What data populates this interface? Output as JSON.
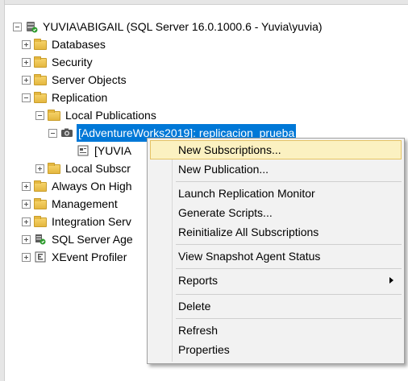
{
  "tree": {
    "server": "YUVIA\\ABIGAIL (SQL Server 16.0.1000.6 - Yuvia\\yuvia)",
    "databases": "Databases",
    "security": "Security",
    "server_objects": "Server Objects",
    "replication": "Replication",
    "local_publications": "Local Publications",
    "publication": "[AdventureWorks2019]: replicacion_prueba",
    "publication_child": "[YUVIA",
    "local_subscriptions": "Local Subscr",
    "always_on": "Always On High",
    "management": "Management",
    "integration": "Integration Serv",
    "agent": "SQL Server Age",
    "xevent": "XEvent Profiler"
  },
  "menu": {
    "new_subscriptions": "New Subscriptions...",
    "new_publication": "New Publication...",
    "launch_monitor": "Launch Replication Monitor",
    "generate_scripts": "Generate Scripts...",
    "reinitialize": "Reinitialize All Subscriptions",
    "view_snapshot": "View Snapshot Agent Status",
    "reports": "Reports",
    "delete": "Delete",
    "refresh": "Refresh",
    "properties": "Properties"
  },
  "colors": {
    "selection": "#0078d7",
    "menu_highlight": "#fbf1c1"
  }
}
